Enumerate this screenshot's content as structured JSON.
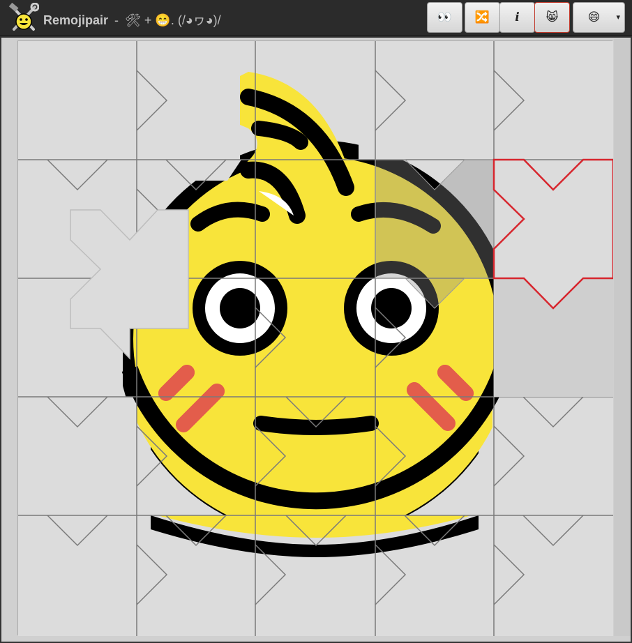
{
  "app": {
    "name": "Remojipair",
    "separator": "-",
    "subtitle": "🛠 + 😁. (/◕ヮ◕)/"
  },
  "toolbar": {
    "buttons": [
      {
        "name": "preview-button",
        "glyph": "👀",
        "icon": "eyes-icon",
        "active": false
      },
      {
        "name": "shuffle-button",
        "glyph": "🔀",
        "icon": "shuffle-icon",
        "active": false
      },
      {
        "name": "info-button",
        "glyph": "i",
        "icon": "info-icon",
        "active": false
      },
      {
        "name": "cat-mode-button",
        "glyph": "😸",
        "icon": "cat-face-icon",
        "active": true
      },
      {
        "name": "emoji-select-button",
        "glyph": "😄",
        "icon": "smiley-icon",
        "active": false,
        "dropdown": "▾"
      }
    ]
  },
  "puzzle": {
    "grid_rows": 5,
    "grid_cols": 5,
    "emoji": "flushed-face",
    "colors": {
      "face": "#f8e43a",
      "outline": "#000000",
      "blush": "#e35d4b",
      "board": "#dcdcdc",
      "highlight": "#d7262e"
    }
  }
}
